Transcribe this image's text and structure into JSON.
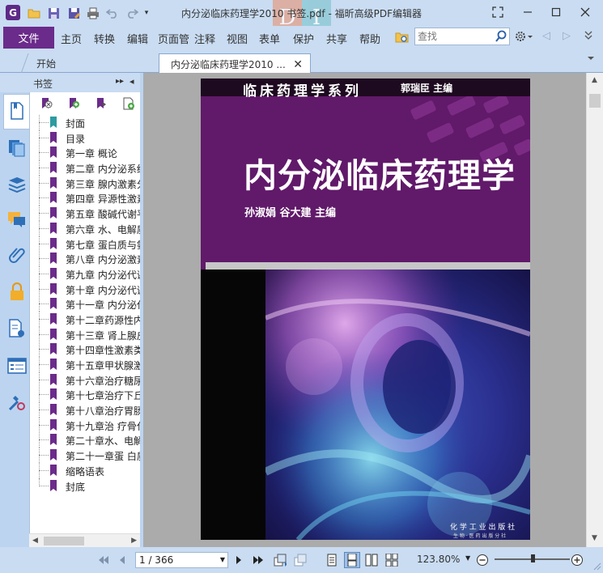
{
  "window": {
    "title": "内分泌临床药理学2010 书签.pdf - 福昕高级PDF编辑器",
    "app_icon": "foxit-g-logo",
    "watermark_left": "D",
    "watermark_right": "I"
  },
  "quick_access": [
    "open-folder-icon",
    "save-icon",
    "save-as-icon",
    "print-icon",
    "undo-icon",
    "redo-icon"
  ],
  "menu": {
    "file_label": "文件",
    "items": [
      "主页",
      "转换",
      "编辑",
      "页面管",
      "注释",
      "视图",
      "表单",
      "保护",
      "共享",
      "帮助"
    ]
  },
  "search": {
    "placeholder": "查找"
  },
  "tabs": {
    "start_label": "开始",
    "doc_label": "内分泌临床药理学2010 ..."
  },
  "bookmarks": {
    "title": "书签",
    "items": [
      "封面",
      "目录",
      "第一章 概论",
      "第二章 内分泌系统",
      "第三章 腺内激素分泌",
      "第四章 异源性激素",
      "第五章 酸碱代谢平衡",
      "第六章 水、电解质",
      "第七章 蛋白质与氨基酸",
      "第八章 内分泌激素",
      "第九章 内分泌代谢",
      "第十章 内分泌代谢",
      "第十一章 内分泌代谢",
      "第十二章药源性内分泌",
      "第十三章 肾上腺皮质",
      "第十四章性激素类",
      "第十五章甲状腺激素",
      "第十六章治疗糖尿病",
      "第十七章治疗下丘脑",
      "第十八章治疗胃肠",
      "第十九章治 疗骨代谢",
      "第二十章水、电解质",
      "第二十一章蛋 白质",
      "缩略语表",
      "封底"
    ]
  },
  "cover": {
    "series": "临床药理学系列",
    "series_editor": "郭瑞臣  主编",
    "title": "内分泌临床药理学",
    "authors": "孙淑娟   谷大建   主编",
    "publisher": "化 学 工 业 出 版 社",
    "publisher_sub": "生 物 · 医 药 出 版 分 社"
  },
  "status": {
    "page_display": "1 / 366",
    "current_page": 1,
    "total_pages": 366,
    "zoom": "123.80%",
    "zoom_level_fraction": 0.5
  },
  "colors": {
    "accent": "#6b2b8a",
    "cover_purple": "#61196a",
    "chrome": "#c9dcf2"
  }
}
